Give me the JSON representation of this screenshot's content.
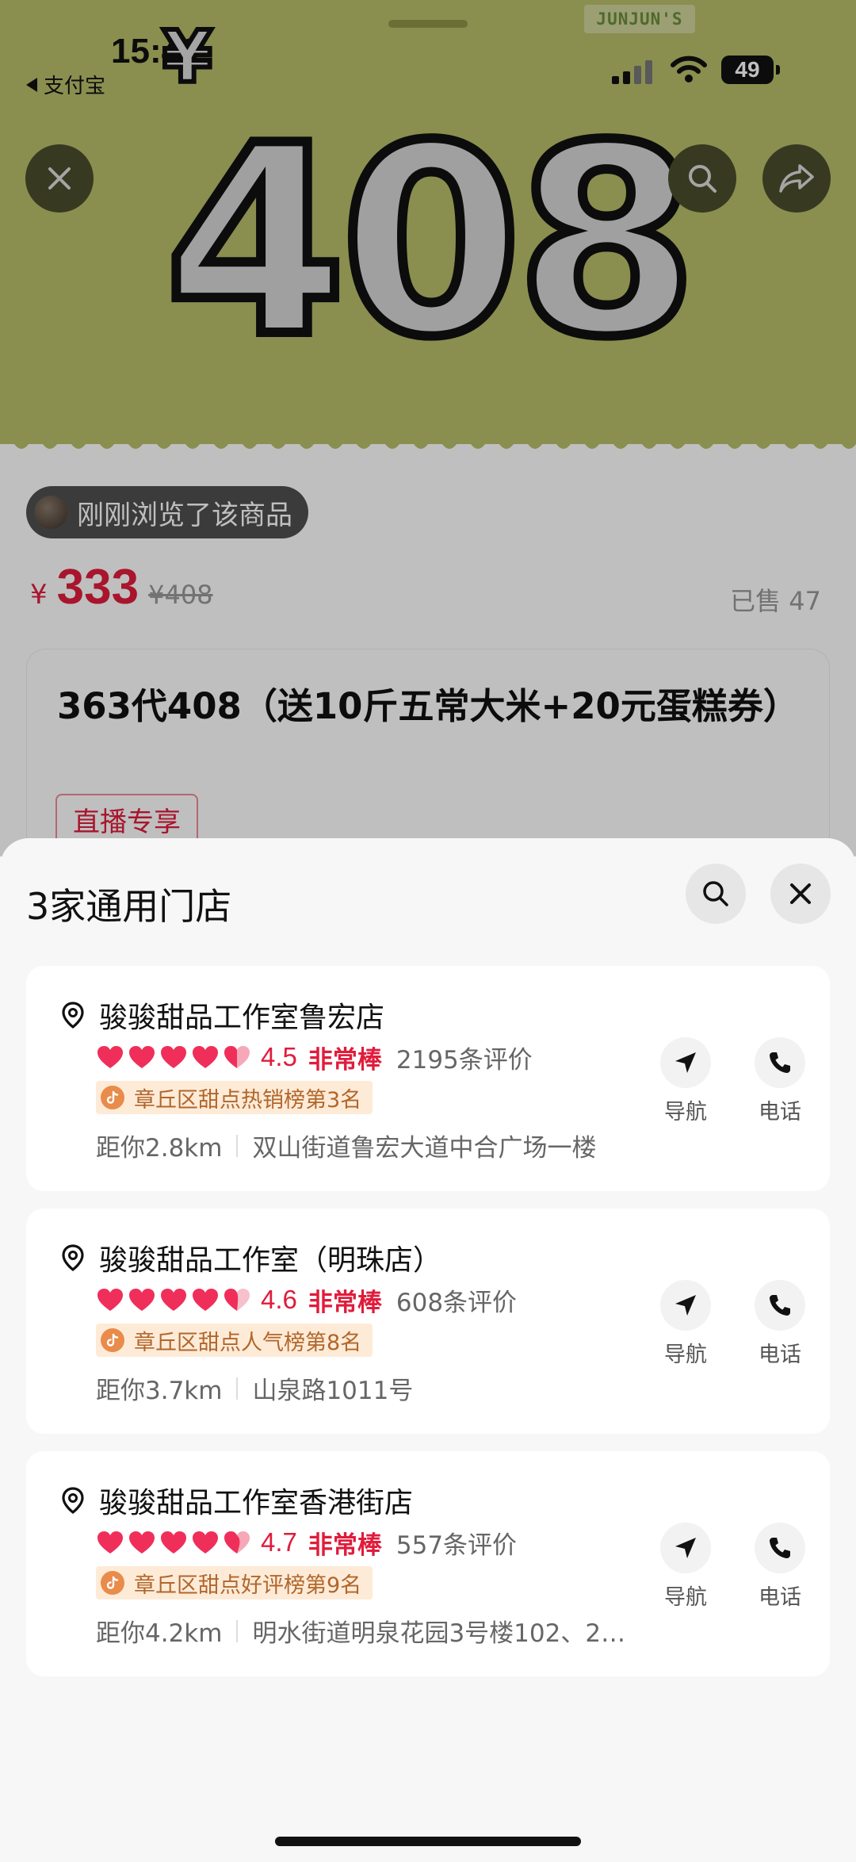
{
  "status_bar": {
    "time": "15:42",
    "back_app": "支付宝",
    "battery": "49"
  },
  "hero": {
    "brand_tag": "JUNJUN'S",
    "yen_symbol": "¥",
    "big_price": "408"
  },
  "product": {
    "browsed_text": "刚刚浏览了该商品",
    "currency": "¥",
    "price": "333",
    "original_price": "¥408",
    "sold": "已售 47",
    "title": "363代408（送10斤五常大米+20元蛋糕券）",
    "tag": "直播专享"
  },
  "sheet": {
    "title": "3家通用门店",
    "stores": [
      {
        "name": "骏骏甜品工作室鲁宏店",
        "score": "4.5",
        "rating_word": "非常棒",
        "reviews": "2195条评价",
        "rank": "章丘区甜点热销榜第3名",
        "distance": "距你2.8km",
        "address": "双山街道鲁宏大道中合广场一楼",
        "nav_label": "导航",
        "call_label": "电话"
      },
      {
        "name": "骏骏甜品工作室（明珠店）",
        "score": "4.6",
        "rating_word": "非常棒",
        "reviews": "608条评价",
        "rank": "章丘区甜点人气榜第8名",
        "distance": "距你3.7km",
        "address": "山泉路1011号",
        "nav_label": "导航",
        "call_label": "电话"
      },
      {
        "name": "骏骏甜品工作室香港街店",
        "score": "4.7",
        "rating_word": "非常棒",
        "reviews": "557条评价",
        "rank": "章丘区甜点好评榜第9名",
        "distance": "距你4.2km",
        "address": "明水街道明泉花园3号楼102、2…",
        "nav_label": "导航",
        "call_label": "电话"
      }
    ]
  },
  "colors": {
    "accent": "#e01c3c",
    "hero_bg": "#b8be6a",
    "rank_bg": "#fdebd8"
  }
}
